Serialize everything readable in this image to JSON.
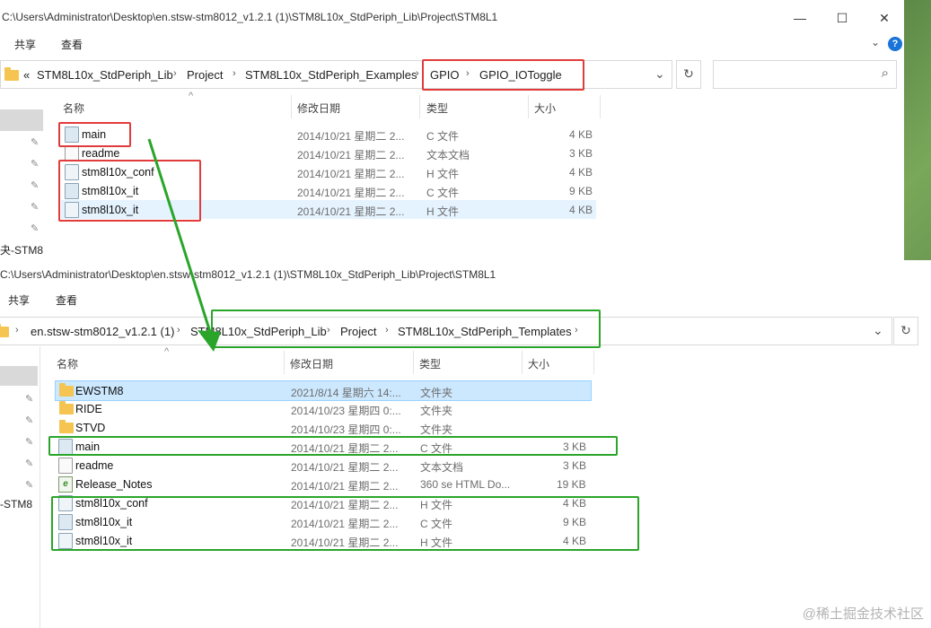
{
  "windows": [
    {
      "title": "C:\\Users\\Administrator\\Desktop\\en.stsw-stm8012_v1.2.1 (1)\\STM8L10x_StdPeriph_Lib\\Project\\STM8L1",
      "menu": [
        "共享",
        "查看"
      ],
      "breadcrumb": [
        "«",
        "STM8L10x_StdPeriph_Lib",
        "Project",
        "STM8L10x_StdPeriph_Examples",
        "GPIO",
        "GPIO_IOToggle"
      ],
      "columns": [
        "名称",
        "修改日期",
        "类型",
        "大小"
      ],
      "side_label": "夬-STM8",
      "files": [
        {
          "name": "main",
          "date": "2014/10/21 星期二 2...",
          "type": "C 文件",
          "size": "4 KB",
          "icon": "c-file-icon"
        },
        {
          "name": "readme",
          "date": "2014/10/21 星期二 2...",
          "type": "文本文档",
          "size": "3 KB",
          "icon": "text-file-icon"
        },
        {
          "name": "stm8l10x_conf",
          "date": "2014/10/21 星期二 2...",
          "type": "H 文件",
          "size": "4 KB",
          "icon": "h-file-icon"
        },
        {
          "name": "stm8l10x_it",
          "date": "2014/10/21 星期二 2...",
          "type": "C 文件",
          "size": "9 KB",
          "icon": "c-file-icon"
        },
        {
          "name": "stm8l10x_it",
          "date": "2014/10/21 星期二 2...",
          "type": "H 文件",
          "size": "4 KB",
          "icon": "h-file-icon"
        }
      ]
    },
    {
      "title": "C:\\Users\\Administrator\\Desktop\\en.stsw-stm8012_v1.2.1 (1)\\STM8L10x_StdPeriph_Lib\\Project\\STM8L1",
      "menu": [
        "共享",
        "查看"
      ],
      "breadcrumb": [
        "en.stsw-stm8012_v1.2.1 (1)",
        "STM8L10x_StdPeriph_Lib",
        "Project",
        "STM8L10x_StdPeriph_Templates"
      ],
      "columns": [
        "名称",
        "修改日期",
        "类型",
        "大小"
      ],
      "side_label": "-STM8",
      "files": [
        {
          "name": "EWSTM8",
          "date": "2021/8/14 星期六 14:...",
          "type": "文件夹",
          "size": "",
          "icon": "folder-icon"
        },
        {
          "name": "RIDE",
          "date": "2014/10/23 星期四 0:...",
          "type": "文件夹",
          "size": "",
          "icon": "folder-icon"
        },
        {
          "name": "STVD",
          "date": "2014/10/23 星期四 0:...",
          "type": "文件夹",
          "size": "",
          "icon": "folder-icon"
        },
        {
          "name": "main",
          "date": "2014/10/21 星期二 2...",
          "type": "C 文件",
          "size": "3 KB",
          "icon": "c-file-icon"
        },
        {
          "name": "readme",
          "date": "2014/10/21 星期二 2...",
          "type": "文本文档",
          "size": "3 KB",
          "icon": "text-file-icon"
        },
        {
          "name": "Release_Notes",
          "date": "2014/10/21 星期二 2...",
          "type": "360 se HTML Do...",
          "size": "19 KB",
          "icon": "html-file-icon"
        },
        {
          "name": "stm8l10x_conf",
          "date": "2014/10/21 星期二 2...",
          "type": "H 文件",
          "size": "4 KB",
          "icon": "h-file-icon"
        },
        {
          "name": "stm8l10x_it",
          "date": "2014/10/21 星期二 2...",
          "type": "C 文件",
          "size": "9 KB",
          "icon": "c-file-icon"
        },
        {
          "name": "stm8l10x_it",
          "date": "2014/10/21 星期二 2...",
          "type": "H 文件",
          "size": "4 KB",
          "icon": "h-file-icon"
        }
      ]
    }
  ],
  "window_controls": {
    "minimize": "—",
    "maximize": "☐",
    "close": "✕",
    "help": "?"
  },
  "icons": {
    "refresh": "↻",
    "search": "⌕",
    "dropdown": "⌄",
    "pin": "📌",
    "sort": "^",
    "chevron": "›"
  },
  "watermark": "@稀土掘金技术社区",
  "colors": {
    "annotation_red": "#e23b3b",
    "annotation_green": "#2aa52a",
    "selection": "#cce8ff"
  }
}
